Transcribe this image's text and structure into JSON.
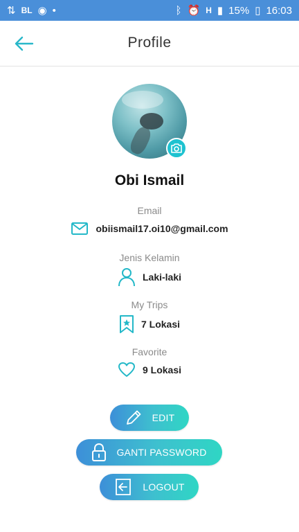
{
  "status_bar": {
    "left_text": "BL",
    "battery": "15%",
    "time": "16:03"
  },
  "header": {
    "title": "Profile"
  },
  "profile": {
    "name": "Obi Ismail",
    "email_label": "Email",
    "email": "obiismail17.oi10@gmail.com",
    "gender_label": "Jenis Kelamin",
    "gender": "Laki-laki",
    "trips_label": "My Trips",
    "trips": "7 Lokasi",
    "favorite_label": "Favorite",
    "favorite": "9 Lokasi"
  },
  "actions": {
    "edit_label": "EDIT",
    "password_label": "GANTI PASSWORD",
    "logout_label": "LOGOUT"
  },
  "colors": {
    "status_bar": "#4a8fd9",
    "accent": "#1ec2d0"
  }
}
